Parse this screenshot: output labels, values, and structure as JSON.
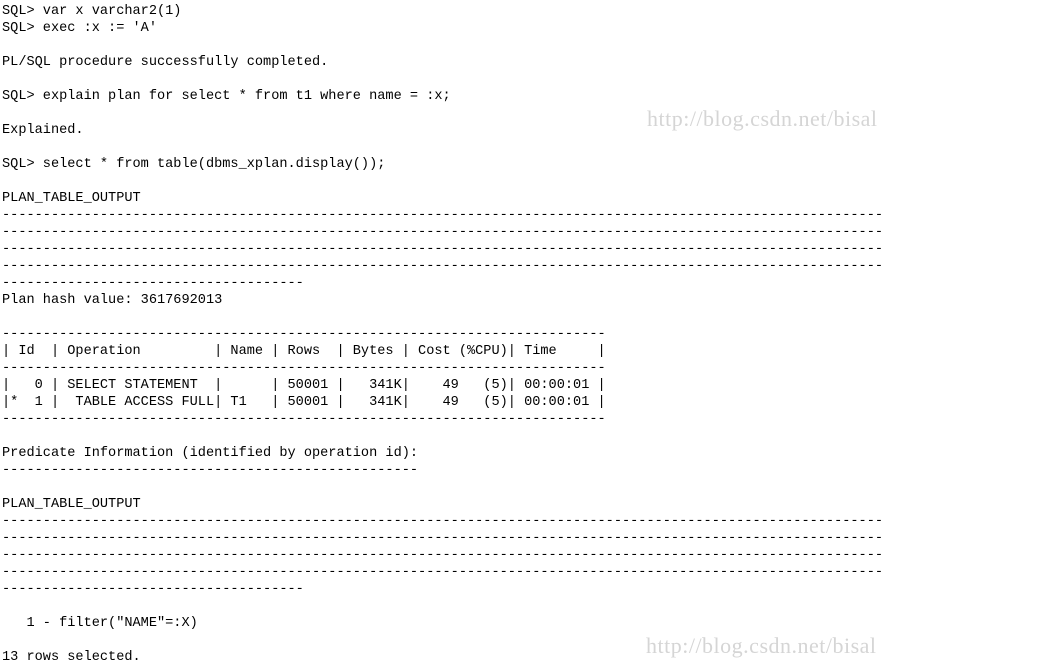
{
  "watermark": {
    "text1": "http://blog.csdn.net/bisal",
    "text2": "http://blog.csdn.net/bisal"
  },
  "lines": {
    "l00": "SQL> var x varchar2(1)",
    "l01": "SQL> exec :x := 'A'",
    "l02": "",
    "l03": "PL/SQL procedure successfully completed.",
    "l04": "",
    "l05": "SQL> explain plan for select * from t1 where name = :x;",
    "l06": "",
    "l07": "Explained.",
    "l08": "",
    "l09": "SQL> select * from table(dbms_xplan.display());",
    "l10": "",
    "l11": "PLAN_TABLE_OUTPUT",
    "l12": "------------------------------------------------------------------------------------------------------------",
    "l13": "------------------------------------------------------------------------------------------------------------",
    "l14": "------------------------------------------------------------------------------------------------------------",
    "l15": "------------------------------------------------------------------------------------------------------------",
    "l16": "-------------------------------------",
    "l17": "Plan hash value: 3617692013",
    "l18": "",
    "l19": "--------------------------------------------------------------------------",
    "l20": "| Id  | Operation         | Name | Rows  | Bytes | Cost (%CPU)| Time     |",
    "l21": "--------------------------------------------------------------------------",
    "l22": "|   0 | SELECT STATEMENT  |      | 50001 |   341K|    49   (5)| 00:00:01 |",
    "l23": "|*  1 |  TABLE ACCESS FULL| T1   | 50001 |   341K|    49   (5)| 00:00:01 |",
    "l24": "--------------------------------------------------------------------------",
    "l25": "",
    "l26": "Predicate Information (identified by operation id):",
    "l27": "---------------------------------------------------",
    "l28": "",
    "l29": "PLAN_TABLE_OUTPUT",
    "l30": "------------------------------------------------------------------------------------------------------------",
    "l31": "------------------------------------------------------------------------------------------------------------",
    "l32": "------------------------------------------------------------------------------------------------------------",
    "l33": "------------------------------------------------------------------------------------------------------------",
    "l34": "-------------------------------------",
    "l35": "",
    "l36": "   1 - filter(\"NAME\"=:X)",
    "l37": "",
    "l38": "13 rows selected."
  }
}
